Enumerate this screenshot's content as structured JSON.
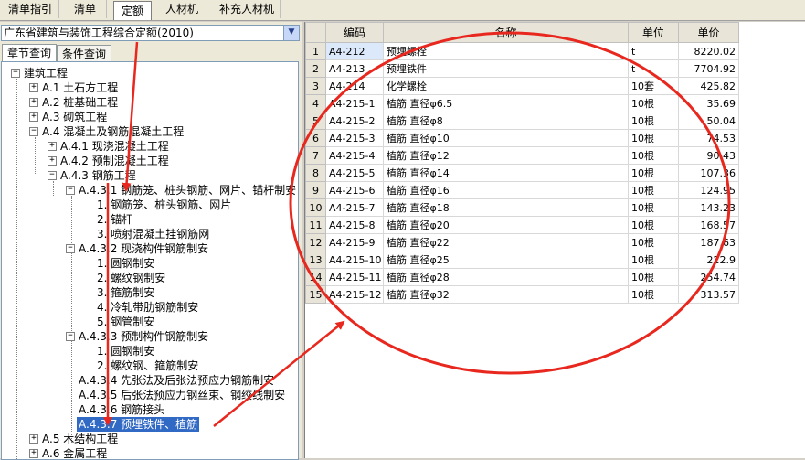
{
  "top_tabs": [
    "清单指引",
    "清单",
    "定额",
    "人材机",
    "补充人材机"
  ],
  "active_tab": "定额",
  "quota_library": "广东省建筑与装饰工程综合定额(2010)",
  "sub_tabs": [
    "章节查询",
    "条件查询"
  ],
  "tree": {
    "root": "建筑工程",
    "a1": "A.1 土石方工程",
    "a2": "A.2 桩基础工程",
    "a3": "A.3 砌筑工程",
    "a4": "A.4 混凝土及钢筋混凝土工程",
    "a41": "A.4.1 现浇混凝土工程",
    "a42": "A.4.2 预制混凝土工程",
    "a43": "A.4.3 钢筋工程",
    "a431": "A.4.3.1 钢筋笼、桩头钢筋、网片、锚杆制安",
    "a431_1": "1. 钢筋笼、桩头钢筋、网片",
    "a431_2": "2. 锚杆",
    "a431_3": "3. 喷射混凝土挂钢筋网",
    "a432": "A.4.3.2 现浇构件钢筋制安",
    "a432_1": "1. 圆钢制安",
    "a432_2": "2. 螺纹钢制安",
    "a432_3": "3. 箍筋制安",
    "a432_4": "4. 冷轧带肋钢筋制安",
    "a432_5": "5. 钢管制安",
    "a433": "A.4.3.3 预制构件钢筋制安",
    "a433_1": "1. 圆钢制安",
    "a433_2": "2. 螺纹钢、箍筋制安",
    "a434": "A.4.3.4 先张法及后张法预应力钢筋制安",
    "a435": "A.4.3.5 后张法预应力钢丝束、钢绞线制安",
    "a436": "A.4.3.6 钢筋接头",
    "a437": "A.4.3.7 预埋铁件、植筋",
    "a5": "A.5 木结构工程",
    "a6": "A.6 金属工程"
  },
  "table": {
    "headers": [
      "编码",
      "名称",
      "单位",
      "单价"
    ],
    "rows": [
      {
        "n": "1",
        "code": "A4-212",
        "name": "预埋螺栓",
        "unit": "t",
        "price": "8220.02"
      },
      {
        "n": "2",
        "code": "A4-213",
        "name": "预埋铁件",
        "unit": "t",
        "price": "7704.92"
      },
      {
        "n": "3",
        "code": "A4-214",
        "name": "化学螺栓",
        "unit": "10套",
        "price": "425.82"
      },
      {
        "n": "4",
        "code": "A4-215-1",
        "name": "植筋 直径φ6.5",
        "unit": "10根",
        "price": "35.69"
      },
      {
        "n": "5",
        "code": "A4-215-2",
        "name": "植筋 直径φ8",
        "unit": "10根",
        "price": "50.04"
      },
      {
        "n": "6",
        "code": "A4-215-3",
        "name": "植筋 直径φ10",
        "unit": "10根",
        "price": "74.53"
      },
      {
        "n": "7",
        "code": "A4-215-4",
        "name": "植筋 直径φ12",
        "unit": "10根",
        "price": "90.43"
      },
      {
        "n": "8",
        "code": "A4-215-5",
        "name": "植筋 直径φ14",
        "unit": "10根",
        "price": "107.36"
      },
      {
        "n": "9",
        "code": "A4-215-6",
        "name": "植筋 直径φ16",
        "unit": "10根",
        "price": "124.95"
      },
      {
        "n": "10",
        "code": "A4-215-7",
        "name": "植筋 直径φ18",
        "unit": "10根",
        "price": "143.23"
      },
      {
        "n": "11",
        "code": "A4-215-8",
        "name": "植筋 直径φ20",
        "unit": "10根",
        "price": "168.57"
      },
      {
        "n": "12",
        "code": "A4-215-9",
        "name": "植筋 直径φ22",
        "unit": "10根",
        "price": "187.63"
      },
      {
        "n": "13",
        "code": "A4-215-10",
        "name": "植筋 直径φ25",
        "unit": "10根",
        "price": "222.9"
      },
      {
        "n": "14",
        "code": "A4-215-11",
        "name": "植筋 直径φ28",
        "unit": "10根",
        "price": "254.74"
      },
      {
        "n": "15",
        "code": "A4-215-12",
        "name": "植筋 直径φ32",
        "unit": "10根",
        "price": "313.57"
      }
    ]
  },
  "colors": {
    "annotation": "#e8281e",
    "selection": "#316ac5"
  },
  "icons": {
    "expand": "plus-box-icon",
    "collapse": "minus-box-icon",
    "dropdown": "chevron-down-icon"
  }
}
